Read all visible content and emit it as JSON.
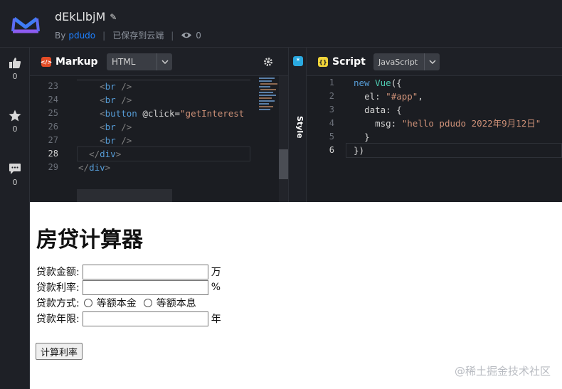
{
  "header": {
    "title": "dEkLlbjM",
    "by_label": "By",
    "author": "pdudo",
    "save_status": "已保存到云端",
    "views": "0"
  },
  "sidebar": {
    "items": [
      {
        "icon": "thumbs-up-icon",
        "count": "0"
      },
      {
        "icon": "star-icon",
        "count": "0"
      },
      {
        "icon": "comment-icon",
        "count": "0"
      }
    ]
  },
  "markup_pane": {
    "title": "Markup",
    "language": "HTML",
    "lines": [
      {
        "num": "23",
        "html": "    <span style='color:#808080'>&lt;</span><span style='color:#569cd6'>br</span> <span style='color:#808080'>/&gt;</span>"
      },
      {
        "num": "24",
        "html": "    <span style='color:#808080'>&lt;</span><span style='color:#569cd6'>br</span> <span style='color:#808080'>/&gt;</span>"
      },
      {
        "num": "25",
        "html": "    <span style='color:#808080'>&lt;</span><span style='color:#569cd6'>button</span> <span style='color:#d4d4d4'>@click=</span><span style='color:#ce9178'>\"getInterest</span>"
      },
      {
        "num": "26",
        "html": "    <span style='color:#808080'>&lt;</span><span style='color:#569cd6'>br</span> <span style='color:#808080'>/&gt;</span>"
      },
      {
        "num": "27",
        "html": "    <span style='color:#808080'>&lt;</span><span style='color:#569cd6'>br</span> <span style='color:#808080'>/&gt;</span>"
      },
      {
        "num": "28",
        "html": "  <span style='color:#808080'>&lt;/</span><span style='color:#569cd6'>div</span><span style='color:#808080'>&gt;</span>"
      },
      {
        "num": "29",
        "html": "<span style='color:#808080'>&lt;/</span><span style='color:#569cd6'>div</span><span style='color:#808080'>&gt;</span>"
      }
    ]
  },
  "style_pane": {
    "title": "Style"
  },
  "script_pane": {
    "title": "Script",
    "language": "JavaScript",
    "lines": [
      {
        "num": "1",
        "html": "<span style='color:#569cd6'>new</span> <span style='color:#4ec9b0'>Vue</span><span style='color:#d4d4d4'>({</span>"
      },
      {
        "num": "2",
        "html": "  <span style='color:#d4d4d4'>el: </span><span style='color:#ce9178'>\"#app\"</span><span style='color:#d4d4d4'>,</span>"
      },
      {
        "num": "3",
        "html": "  <span style='color:#d4d4d4'>data: {</span>"
      },
      {
        "num": "4",
        "html": "    <span style='color:#d4d4d4'>msg: </span><span style='color:#ce9178'>\"hello pdudo 2022年9月12日\"</span>"
      },
      {
        "num": "5",
        "html": "  <span style='color:#d4d4d4'>}</span>"
      },
      {
        "num": "6",
        "html": "<span style='color:#d4d4d4'>})</span>"
      }
    ]
  },
  "result": {
    "heading": "房贷计算器",
    "amount_label": "贷款金额:",
    "amount_unit": "万",
    "rate_label": "贷款利率:",
    "rate_unit": "%",
    "method_label": "贷款方式:",
    "method_option1": "等额本金",
    "method_option2": "等额本息",
    "years_label": "贷款年限:",
    "years_unit": "年",
    "calc_button": "计算利率"
  },
  "watermark": "@稀土掘金技术社区",
  "colors": {
    "accent_blue": "#1e80ff",
    "logo_purple": "#7b61ff",
    "markup_badge": "#e34c26",
    "style_badge": "#2aa9e0",
    "script_badge": "#f0d43a"
  }
}
